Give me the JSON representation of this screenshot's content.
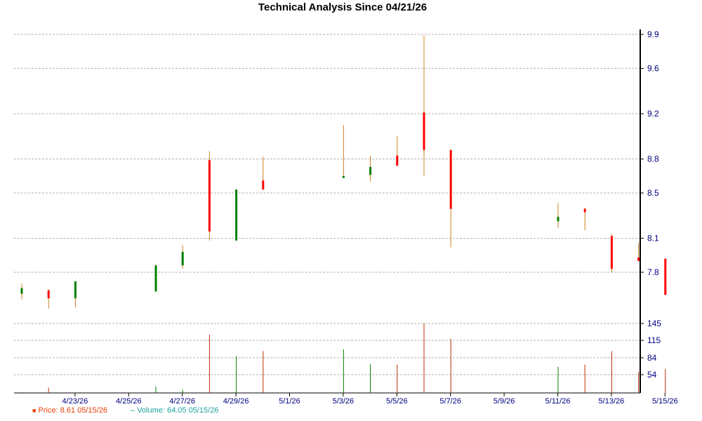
{
  "chart_title": "Technical Analysis Since 04/21/26",
  "legend": {
    "price": {
      "label": "Price: 8.61  05/15/26",
      "color": "#e8400a",
      "symbol": "■"
    },
    "volume": {
      "label": "Volume: 64.05  05/15/26",
      "color": "#20a0a0",
      "symbol": "–"
    }
  },
  "colors": {
    "up": "#008000",
    "down": "#ff0000",
    "wick": "#d08020",
    "vol_up": "#008000",
    "vol_down": "#c03000",
    "axis_text": "#000080",
    "grid": "#b0b0b0"
  },
  "chart_data": {
    "type": "candlestick",
    "title": "Technical Analysis Since 04/21/26",
    "price_ticks": [
      7.8,
      8.1,
      8.5,
      8.8,
      9.2,
      9.6,
      9.9
    ],
    "price_tick_labels": [
      "7.8",
      "8.1",
      "8.5",
      "8.8",
      "9.2",
      "9.6",
      "9.9"
    ],
    "volume_ticks": [
      54,
      84,
      115,
      145
    ],
    "volume_tick_labels": [
      "54",
      "84",
      "115",
      "145"
    ],
    "x_tick_labels": [
      "4/23/26",
      "4/25/26",
      "4/27/26",
      "4/29/26",
      "5/1/26",
      "5/3/26",
      "5/5/26",
      "5/7/26",
      "5/9/26",
      "5/11/26",
      "5/13/26",
      "5/15/26"
    ],
    "x_tick_days": [
      2,
      4,
      6,
      8,
      10,
      12,
      14,
      16,
      18,
      20,
      22,
      24
    ],
    "ylim_price": [
      7.4,
      9.9
    ],
    "ylim_volume": [
      24,
      145
    ],
    "grid": true,
    "candles": [
      {
        "day": 0,
        "open": 7.61,
        "close": 7.66,
        "high": 7.7,
        "low": 7.56,
        "volume": 20
      },
      {
        "day": 1,
        "open": 7.64,
        "close": 7.57,
        "high": 7.65,
        "low": 7.48,
        "volume": 31
      },
      {
        "day": 2,
        "open": 7.57,
        "close": 7.72,
        "high": 7.72,
        "low": 7.49,
        "volume": 22
      },
      {
        "day": 5,
        "open": 7.63,
        "close": 7.86,
        "high": 7.87,
        "low": 7.63,
        "volume": 33
      },
      {
        "day": 6,
        "open": 7.86,
        "close": 7.98,
        "high": 8.04,
        "low": 7.83,
        "volume": 27
      },
      {
        "day": 7,
        "open": 8.79,
        "close": 8.16,
        "high": 8.87,
        "low": 8.08,
        "volume": 125
      },
      {
        "day": 8,
        "open": 8.08,
        "close": 8.53,
        "high": 8.53,
        "low": 8.08,
        "volume": 87
      },
      {
        "day": 9,
        "open": 8.61,
        "close": 8.53,
        "high": 8.82,
        "low": 8.53,
        "volume": 96
      },
      {
        "day": 12,
        "open": 8.64,
        "close": 8.65,
        "high": 9.1,
        "low": 8.64,
        "volume": 99
      },
      {
        "day": 13,
        "open": 8.66,
        "close": 8.73,
        "high": 8.83,
        "low": 8.6,
        "volume": 73
      },
      {
        "day": 14,
        "open": 8.83,
        "close": 8.74,
        "high": 9.0,
        "low": 8.74,
        "volume": 72
      },
      {
        "day": 15,
        "open": 9.21,
        "close": 8.88,
        "high": 9.89,
        "low": 8.65,
        "volume": 145
      },
      {
        "day": 16,
        "open": 8.88,
        "close": 8.36,
        "high": 8.88,
        "low": 8.02,
        "volume": 118
      },
      {
        "day": 20,
        "open": 8.25,
        "close": 8.29,
        "high": 8.41,
        "low": 8.19,
        "volume": 68
      },
      {
        "day": 21,
        "open": 8.36,
        "close": 8.33,
        "high": 8.37,
        "low": 8.17,
        "volume": 72
      },
      {
        "day": 22,
        "open": 8.12,
        "close": 7.83,
        "high": 8.14,
        "low": 7.8,
        "volume": 96
      },
      {
        "day": 23,
        "open": 7.93,
        "close": 7.9,
        "high": 8.06,
        "low": 7.9,
        "volume": 59
      },
      {
        "day": 24,
        "open": 7.92,
        "close": 7.6,
        "high": 7.92,
        "low": 7.6,
        "volume": 64.05
      }
    ]
  }
}
